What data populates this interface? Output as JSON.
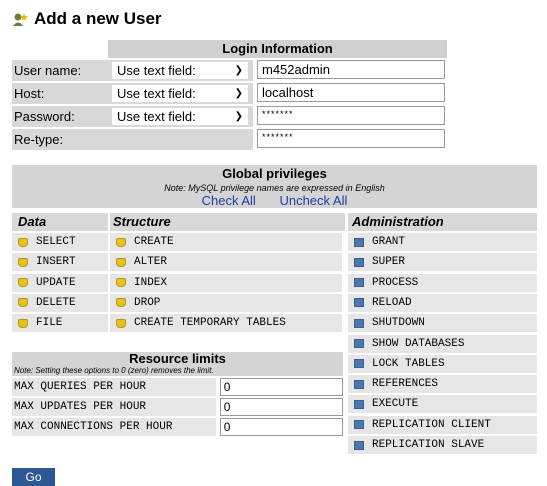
{
  "page": {
    "title": "Add a new User"
  },
  "login": {
    "header": "Login Information",
    "rows": [
      {
        "label": "User name:",
        "select": "Use text field:",
        "value": "m452admin"
      },
      {
        "label": "Host:",
        "select": "Use text field:",
        "value": "localhost"
      },
      {
        "label": "Password:",
        "select": "Use text field:",
        "value": "*******"
      },
      {
        "label": "Re-type:",
        "select": "",
        "value": "*******"
      }
    ]
  },
  "global": {
    "header": "Global privileges",
    "note": "Note: MySQL privilege names are expressed in English",
    "check_all": "Check All",
    "uncheck_all": "Uncheck All",
    "columns": {
      "data": "Data",
      "structure": "Structure",
      "administration": "Administration"
    },
    "data": [
      "SELECT",
      "INSERT",
      "UPDATE",
      "DELETE",
      "FILE"
    ],
    "structure": [
      "CREATE",
      "ALTER",
      "INDEX",
      "DROP",
      "CREATE TEMPORARY TABLES"
    ],
    "administration": [
      "GRANT",
      "SUPER",
      "PROCESS",
      "RELOAD",
      "SHUTDOWN",
      "SHOW DATABASES",
      "LOCK TABLES",
      "REFERENCES",
      "EXECUTE",
      "REPLICATION CLIENT",
      "REPLICATION SLAVE"
    ]
  },
  "resources": {
    "header": "Resource limits",
    "note": "Note: Setting these options to 0 (zero) removes the limit.",
    "rows": [
      {
        "label": "MAX QUERIES PER HOUR",
        "value": "0"
      },
      {
        "label": "MAX UPDATES PER HOUR",
        "value": "0"
      },
      {
        "label": "MAX CONNECTIONS PER HOUR",
        "value": "0"
      }
    ]
  },
  "go_label": "Go",
  "icons": {
    "title": "add-user-icon",
    "data": "database-yellow-icon",
    "structure": "structure-yellow-icon",
    "admin": "admin-blue-icon"
  },
  "colors": {
    "link": "#1a3fa0",
    "header_bg": "#d4d4d4",
    "row_bg": "#e6e6e6",
    "go_button": "#2c5896"
  }
}
